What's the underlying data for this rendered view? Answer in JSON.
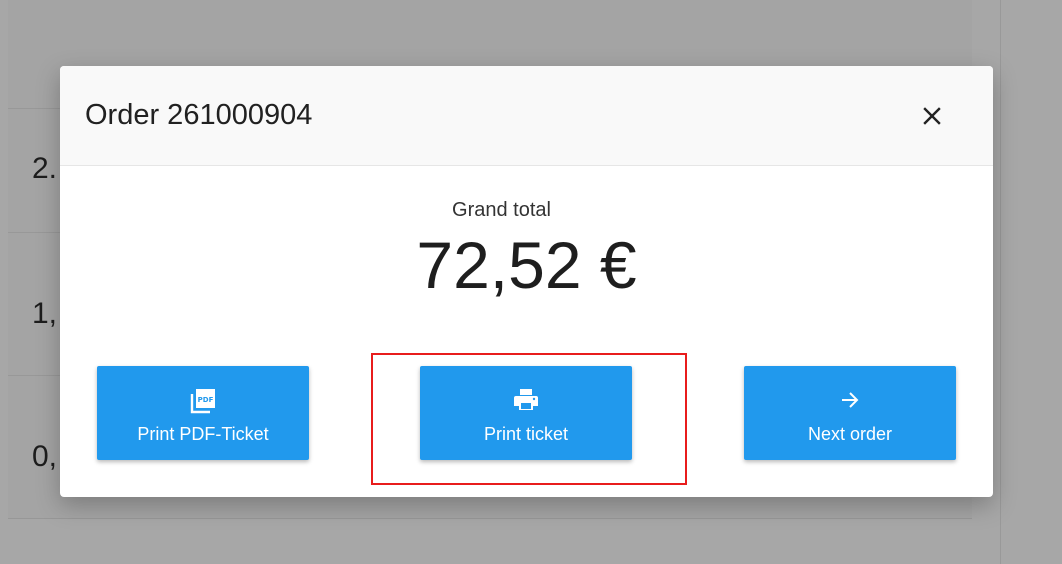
{
  "background": {
    "rows": [
      {
        "value": "2."
      },
      {
        "value": "1,"
      },
      {
        "value": "0,"
      }
    ]
  },
  "dialog": {
    "title": "Order 261000904",
    "close_icon": "close-icon",
    "total_label": "Grand total",
    "total_value": "72,52 €",
    "buttons": [
      {
        "label": "Print PDF-Ticket",
        "icon": "pdf-icon"
      },
      {
        "label": "Print ticket",
        "icon": "printer-icon"
      },
      {
        "label": "Next order",
        "icon": "arrow-right-icon"
      }
    ]
  },
  "colors": {
    "accent": "#2199ed",
    "overlay": "#a7a7a7",
    "highlight": "#e81c1c"
  }
}
